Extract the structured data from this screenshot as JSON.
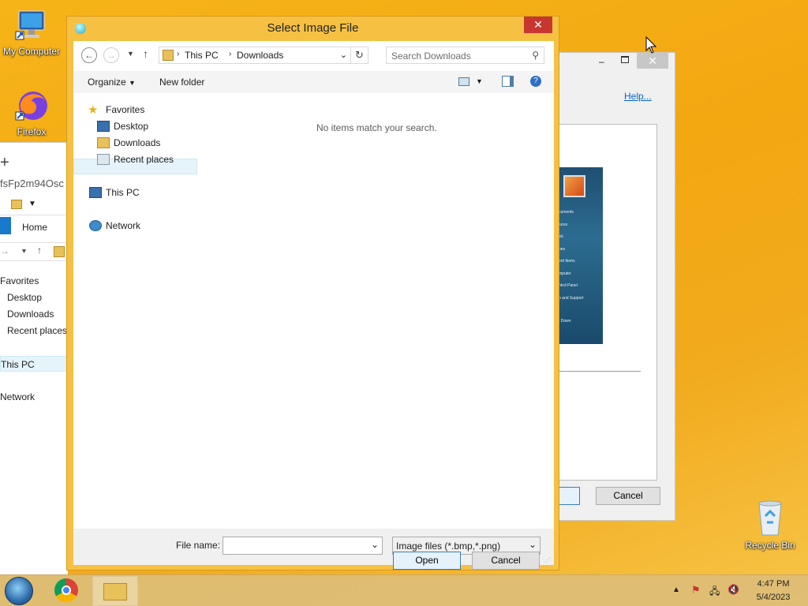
{
  "desktop": {
    "icons": [
      {
        "label": "My Computer"
      },
      {
        "label": "Firefox"
      },
      {
        "label": "Recycle Bin"
      }
    ]
  },
  "background_explorer": {
    "address_fragment": "fsFp2m94Osc",
    "tab_home": "Home",
    "nav": [
      "Favorites",
      "Desktop",
      "Downloads",
      "Recent places",
      "This PC",
      "Network"
    ]
  },
  "background_dialog": {
    "help_link": "Help...",
    "cancel_label": "Cancel",
    "start_menu_items": [
      "cuments",
      "tures",
      "sic",
      "nes",
      "ent Items",
      "mputer",
      "ntrol Panel",
      "p and Support",
      "t Down"
    ]
  },
  "dialog": {
    "title": "Select Image File",
    "breadcrumb": [
      "This PC",
      "Downloads"
    ],
    "search_placeholder": "Search Downloads",
    "organize_label": "Organize",
    "new_folder_label": "New folder",
    "nav": {
      "favorites": "Favorites",
      "desktop": "Desktop",
      "downloads": "Downloads",
      "recent": "Recent places",
      "this_pc": "This PC",
      "network": "Network"
    },
    "empty_message": "No items match your search.",
    "file_name_label": "File name:",
    "file_name_value": "",
    "file_type": "Image files (*.bmp,*.png)",
    "open_label": "Open",
    "cancel_label": "Cancel"
  },
  "taskbar": {
    "time": "4:47 PM",
    "date": "5/4/2023"
  },
  "colors": {
    "desktop": "#f3a712",
    "dialog_frame": "#f6c143",
    "close_button": "#c7372f",
    "selection": "#e5f3fb"
  }
}
